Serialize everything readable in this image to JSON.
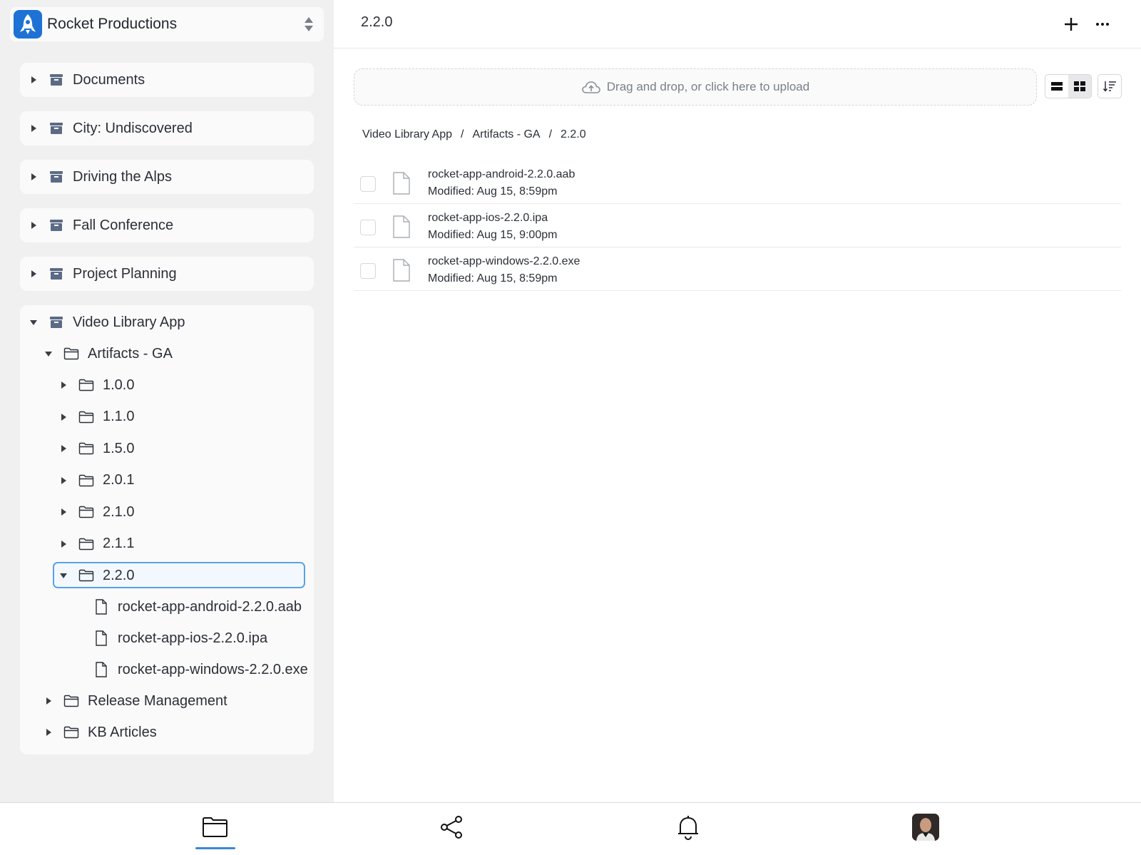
{
  "org": {
    "name": "Rocket Productions"
  },
  "sidebar": {
    "libraries": [
      {
        "label": "Documents"
      },
      {
        "label": "City: Undiscovered"
      },
      {
        "label": "Driving the Alps"
      },
      {
        "label": "Fall Conference"
      },
      {
        "label": "Project Planning"
      }
    ],
    "open_library": {
      "label": "Video Library App",
      "folder": {
        "label": "Artifacts - GA",
        "versions": [
          "1.0.0",
          "1.1.0",
          "1.5.0",
          "2.0.1",
          "2.1.0",
          "2.1.1"
        ],
        "selected": {
          "label": "2.2.0",
          "files": [
            "rocket-app-android-2.2.0.aab",
            "rocket-app-ios-2.2.0.ipa",
            "rocket-app-windows-2.2.0.exe"
          ]
        }
      },
      "other_folders": [
        "Release Management",
        "KB Articles"
      ]
    }
  },
  "main": {
    "title": "2.2.0",
    "upload_text": "Drag and drop, or click here to upload",
    "breadcrumb": [
      "Video Library App",
      "Artifacts - GA",
      "2.2.0"
    ],
    "breadcrumb_sep": "/",
    "files": [
      {
        "name": "rocket-app-android-2.2.0.aab",
        "modified": "Modified: Aug 15, 8:59pm"
      },
      {
        "name": "rocket-app-ios-2.2.0.ipa",
        "modified": "Modified: Aug 15, 9:00pm"
      },
      {
        "name": "rocket-app-windows-2.2.0.exe",
        "modified": "Modified: Aug 15, 8:59pm"
      }
    ]
  },
  "bottom_nav": {
    "items": [
      {
        "icon": "folder-icon",
        "active": true
      },
      {
        "icon": "share-icon",
        "active": false
      },
      {
        "icon": "bell-icon",
        "active": false
      },
      {
        "icon": "avatar",
        "active": false
      }
    ]
  },
  "colors": {
    "accent": "#3a86d8",
    "sidebar_bg": "#f0f0f1",
    "library_icon": "#5b6b86"
  }
}
